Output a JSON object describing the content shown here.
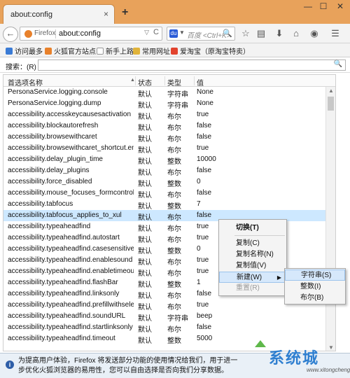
{
  "tab": {
    "title": "about:config",
    "close": "×"
  },
  "new_tab": "+",
  "window": {
    "minimize": "—",
    "maximize": "☐",
    "close": "✕"
  },
  "urlbar": {
    "identity": "Firefox",
    "url": "about:config",
    "dropdown": "▽",
    "reload": "C"
  },
  "searchbar": {
    "placeholder": "百度 <Ctrl+K>",
    "engine": "du",
    "dropdown": "▼",
    "go": "🔍"
  },
  "toolbar_icons": [
    "star-icon",
    "bookmarks-list-icon",
    "download-icon",
    "home-icon",
    "menu-icon"
  ],
  "bookmarks": [
    {
      "label": "访问最多",
      "icon_color": "#3a7bd5"
    },
    {
      "label": "火狐官方站点",
      "icon_color": "#e8812b"
    },
    {
      "label": "新手上路",
      "icon_color": "#ffffff"
    },
    {
      "label": "常用网址",
      "icon_color": "#e0b33a"
    },
    {
      "label": "爱淘宝（原淘宝特卖）",
      "icon_color": "#e2432e"
    }
  ],
  "search": {
    "label": "搜索：(R)",
    "value": ""
  },
  "table": {
    "headers": {
      "name": "首选项名称",
      "status": "状态",
      "type": "类型",
      "value": "值"
    },
    "rows": [
      {
        "name": "PersonaService.logging.console",
        "status": "默认",
        "type": "字符串",
        "value": "None"
      },
      {
        "name": "PersonaService.logging.dump",
        "status": "默认",
        "type": "字符串",
        "value": "None"
      },
      {
        "name": "accessibility.accesskeycausesactivation",
        "status": "默认",
        "type": "布尔",
        "value": "true"
      },
      {
        "name": "accessibility.blockautorefresh",
        "status": "默认",
        "type": "布尔",
        "value": "false"
      },
      {
        "name": "accessibility.browsewithcaret",
        "status": "默认",
        "type": "布尔",
        "value": "false"
      },
      {
        "name": "accessibility.browsewithcaret_shortcut.en...",
        "status": "默认",
        "type": "布尔",
        "value": "true"
      },
      {
        "name": "accessibility.delay_plugin_time",
        "status": "默认",
        "type": "整数",
        "value": "10000"
      },
      {
        "name": "accessibility.delay_plugins",
        "status": "默认",
        "type": "布尔",
        "value": "false"
      },
      {
        "name": "accessibility.force_disabled",
        "status": "默认",
        "type": "整数",
        "value": "0"
      },
      {
        "name": "accessibility.mouse_focuses_formcontrol",
        "status": "默认",
        "type": "布尔",
        "value": "false"
      },
      {
        "name": "accessibility.tabfocus",
        "status": "默认",
        "type": "整数",
        "value": "7"
      },
      {
        "name": "accessibility.tabfocus_applies_to_xul",
        "status": "默认",
        "type": "布尔",
        "value": "false"
      },
      {
        "name": "accessibility.typeaheadfind",
        "status": "默认",
        "type": "布尔",
        "value": "true"
      },
      {
        "name": "accessibility.typeaheadfind.autostart",
        "status": "默认",
        "type": "布尔",
        "value": "true"
      },
      {
        "name": "accessibility.typeaheadfind.casesensitive",
        "status": "默认",
        "type": "整数",
        "value": "0"
      },
      {
        "name": "accessibility.typeaheadfind.enablesound",
        "status": "默认",
        "type": "布尔",
        "value": "true"
      },
      {
        "name": "accessibility.typeaheadfind.enabletimeout",
        "status": "默认",
        "type": "布尔",
        "value": "true"
      },
      {
        "name": "accessibility.typeaheadfind.flashBar",
        "status": "默认",
        "type": "整数",
        "value": "1"
      },
      {
        "name": "accessibility.typeaheadfind.linksonly",
        "status": "默认",
        "type": "布尔",
        "value": "false"
      },
      {
        "name": "accessibility.typeaheadfind.prefillwithsele...",
        "status": "默认",
        "type": "布尔",
        "value": "true"
      },
      {
        "name": "accessibility.typeaheadfind.soundURL",
        "status": "默认",
        "type": "字符串",
        "value": "beep"
      },
      {
        "name": "accessibility.typeaheadfind.startlinksonly",
        "status": "默认",
        "type": "布尔",
        "value": "false"
      },
      {
        "name": "accessibility.typeaheadfind.timeout",
        "status": "默认",
        "type": "整数",
        "value": "5000"
      }
    ],
    "selected_index": 11
  },
  "context_menu": {
    "toggle": "切换(T)",
    "copy": "复制(C)",
    "copy_name": "复制名称(N)",
    "copy_value": "复制值(V)",
    "new": "新建(W)",
    "reset": "重置(R)",
    "submenu": {
      "string": "字符串(S)",
      "integer": "整数(I)",
      "boolean": "布尔(B)"
    }
  },
  "notification": {
    "text": "为提高用户体验，Firefox 将发送部分功能的使用情况给我们，用于进一步优化火狐浏览器的易用性，您可以自由选择是否向我们分享数据。"
  },
  "watermark": {
    "brand": "系统城",
    "url": "www.xitongcheng.com"
  }
}
